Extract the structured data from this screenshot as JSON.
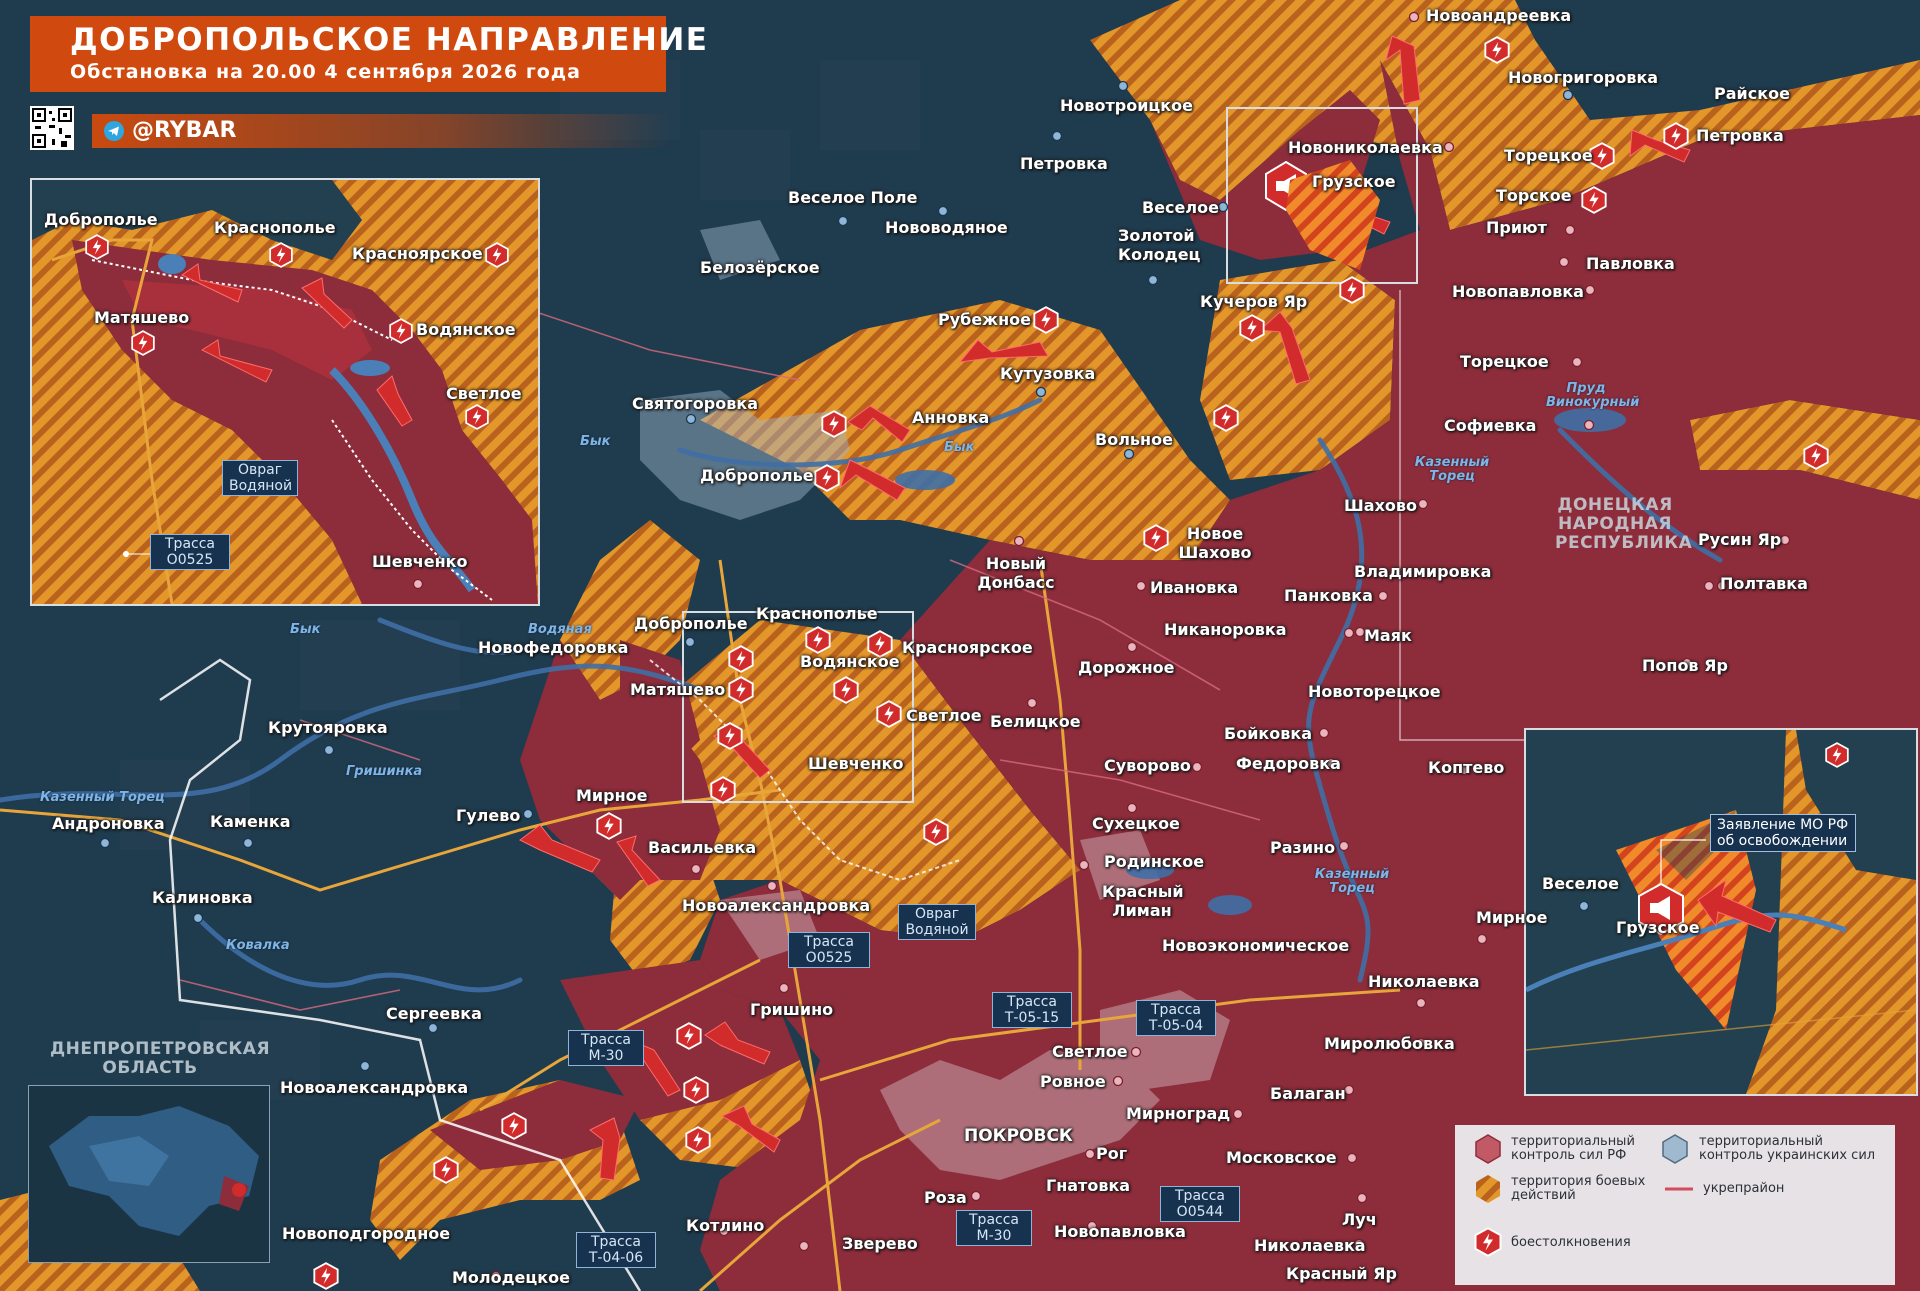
{
  "header": {
    "title": "ДОБРОПОЛЬСКОЕ НАПРАВЛЕНИЕ",
    "subtitle": "Обстановка на 20.00 4 сентября 2026 года",
    "channel": "@RYBAR"
  },
  "colors": {
    "rf_control": "#8d2c3a",
    "combat_zone": "#e3962a",
    "ua_control": "#1d3a4c",
    "clash_marker": "#d22b2b",
    "accent": "#d04a10"
  },
  "regions": {
    "dpr": "ДОНЕЦКАЯ НАРОДНАЯ РЕСПУБЛИКА",
    "dnipro": "ДНЕПРОПЕТРОВСКАЯ ОБЛАСТЬ"
  },
  "places": {
    "novoandreevka": "Новоандреевка",
    "novogrigorovka": "Новогригоровка",
    "raiskoe": "Райское",
    "novotroitskoe": "Новотроицкое",
    "petrovka_n": "Петровка",
    "novonikolaevka": "Новониколаевка",
    "torezkoe_top": "Торецкое",
    "petrovka_ne": "Петровка",
    "veseloe_pole": "Веселое Поле",
    "novovodyanoe": "Нововодяное",
    "veseloe": "Веселое",
    "gruzskoe": "Грузское",
    "torskoe": "Торское",
    "priyut": "Приют",
    "zolotoy_kolodets": "Золотой Колодец",
    "belozerskoe": "Белозёрское",
    "pavlovka": "Павловка",
    "kucherov_yar": "Кучеров Яр",
    "novopavlovka_n": "Новопавловка",
    "rubezhnoe": "Рубежное",
    "kutuzovka": "Кутузовка",
    "torezkoe": "Торецкое",
    "svyatogorovka": "Святогоровка",
    "annovka": "Анновка",
    "volnoe": "Вольное",
    "sofievka": "Софиевка",
    "dobropolie": "Доброполье",
    "shakhovo": "Шахово",
    "novoe_shakhovo": "Новое Шахово",
    "rusin_yar": "Русин Яр",
    "novy_donbass": "Новый Донбасс",
    "vladimirovka": "Владимировка",
    "ivanovka": "Ивановка",
    "pankovka": "Панковка",
    "poltavka": "Полтавка",
    "dobropolie_2": "Доброполье",
    "krasnopodolie": "Краснополье",
    "novofedorovka": "Новофедоровка",
    "krasnoyarskoe": "Красноярское",
    "nikanorovka": "Никаноровка",
    "mayak": "Маяк",
    "vodyanskoe": "Водянское",
    "dorozhnoe": "Дорожное",
    "popov_yar": "Попов Яр",
    "matyashevo": "Матяшево",
    "novotoretskoe": "Новоторецкое",
    "svetloe": "Светлое",
    "belitskoe": "Белицкое",
    "krutoyarovka": "Крутояровка",
    "boikovka": "Бойковка",
    "shevchenko": "Шевченко",
    "suvorovo": "Суворово",
    "fedorovka": "Федоровка",
    "koptevo": "Коптево",
    "mirnoe": "Мирное",
    "andronovka": "Андроновка",
    "kamenka": "Каменка",
    "gulevo": "Гулево",
    "vasilievka": "Васильевка",
    "sukhetskoe": "Сухецкое",
    "razino": "Разино",
    "rodinskoe": "Родинское",
    "krasny_liman": "Красный Лиман",
    "kalinovka": "Калиновка",
    "novoaleksandrovka_c": "Новоалександровка",
    "mirnoe_e": "Мирное",
    "novoekonomicheskoe": "Новоэкономическое",
    "nikolaevka": "Николаевка",
    "grishino": "Гришино",
    "sergeevka": "Сергеевка",
    "mirolyubovka": "Миролюбовка",
    "svetloe_s": "Светлое",
    "rovnoe": "Ровное",
    "novoaleksandrovka_w": "Новоалександровка",
    "balagan": "Балаган",
    "mirnograd": "Мирноград",
    "pokrovsk": "ПОКРОВСК",
    "rog": "Рог",
    "moskovskoe": "Московское",
    "roza": "Роза",
    "gnatovka": "Гнатовка",
    "kotlino": "Котлино",
    "luch": "Луч",
    "novopodgorodnoe": "Новоподгородное",
    "zverevo": "Зверево",
    "novopavlovka_s": "Новопавловка",
    "nikolaevka_s": "Николаевка",
    "molodetskoe": "Молодецкое",
    "krasny_yar": "Красный Яр",
    "ovrag_vodyanoy": "Овраг Водяной"
  },
  "water": {
    "byk_1": "Бык",
    "byk_2": "Бык",
    "byk_3": "Бык",
    "vodyanaya": "Водяная",
    "grishinka": "Гришинка",
    "kazenny_torets_1": "Казенный Торец",
    "kazenny_torets_2": "Казенный Торец",
    "prud_vinokurny": "Пруд Винокурный",
    "kazenny_torets_3": "Казенный Торец",
    "kovalka": "Ковалка"
  },
  "roads": {
    "t0525_main": "Трасса О0525",
    "t0515": "Трасса Т-05-15",
    "t0504": "Трасса Т-05-04",
    "m30_w": "Трасса М-30",
    "m30_s": "Трасса М-30",
    "t0544": "Трасса О0544",
    "t0406": "Трасса Т-04-06"
  },
  "inset_left": {
    "dobropolie": "Доброполье",
    "krasnopodolie": "Краснополье",
    "krasnoyarskoe": "Красноярское",
    "matyashevo": "Матяшево",
    "vodyanskoe": "Водянское",
    "svetloe": "Светлое",
    "shevchenko": "Шевченко",
    "ovrag": "Овраг Водяной",
    "road": "Трасса О0525"
  },
  "inset_right": {
    "veseloe": "Веселое",
    "gruzskoe": "Грузское",
    "statement": "Заявление МО РФ об освобождении"
  },
  "legend": {
    "rf_control": "территориальный контроль сил РФ",
    "ua_control": "территориальный контроль украинских сил",
    "combat_zone": "территория боевых действий",
    "fortified": "укрепрайон",
    "clashes": "боестолкновения"
  }
}
